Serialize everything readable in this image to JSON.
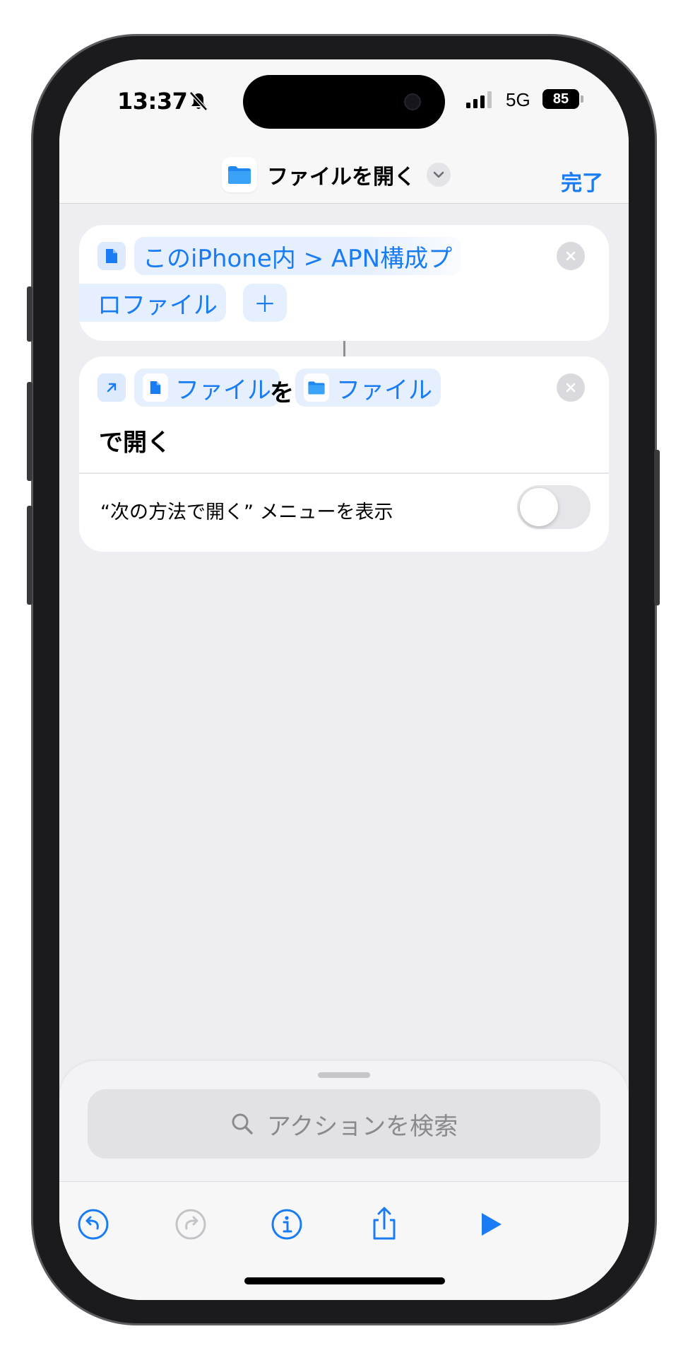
{
  "status_bar": {
    "time": "13:37",
    "network": "5G",
    "battery": "85",
    "icons": [
      "bell-slash-icon",
      "cellular-signal-icon"
    ]
  },
  "nav": {
    "title": "ファイルを開く",
    "done_label": "完了",
    "icons": [
      "folder-icon",
      "chevron-down-icon"
    ]
  },
  "actions": [
    {
      "icon": "document-icon",
      "path_line1": "このiPhone内 > APN構成プ",
      "path_line2": "ロファイル",
      "add_label": "＋"
    },
    {
      "icon": "open-arrow-icon",
      "file_param": "ファイル",
      "connector_text": "を",
      "app_param": "ファイル",
      "suffix_text": "で開く",
      "toggle_label": "“次の方法で開く” メニューを表示",
      "toggle_on": false
    }
  ],
  "bottom_sheet": {
    "search_placeholder": "アクションを検索",
    "toolbar_icons": [
      "undo-icon",
      "redo-icon",
      "info-icon",
      "share-icon",
      "play-icon"
    ]
  },
  "colors": {
    "accent": "#1a7cf5",
    "chip_background": "#e5effd",
    "background": "#eeeef2"
  }
}
